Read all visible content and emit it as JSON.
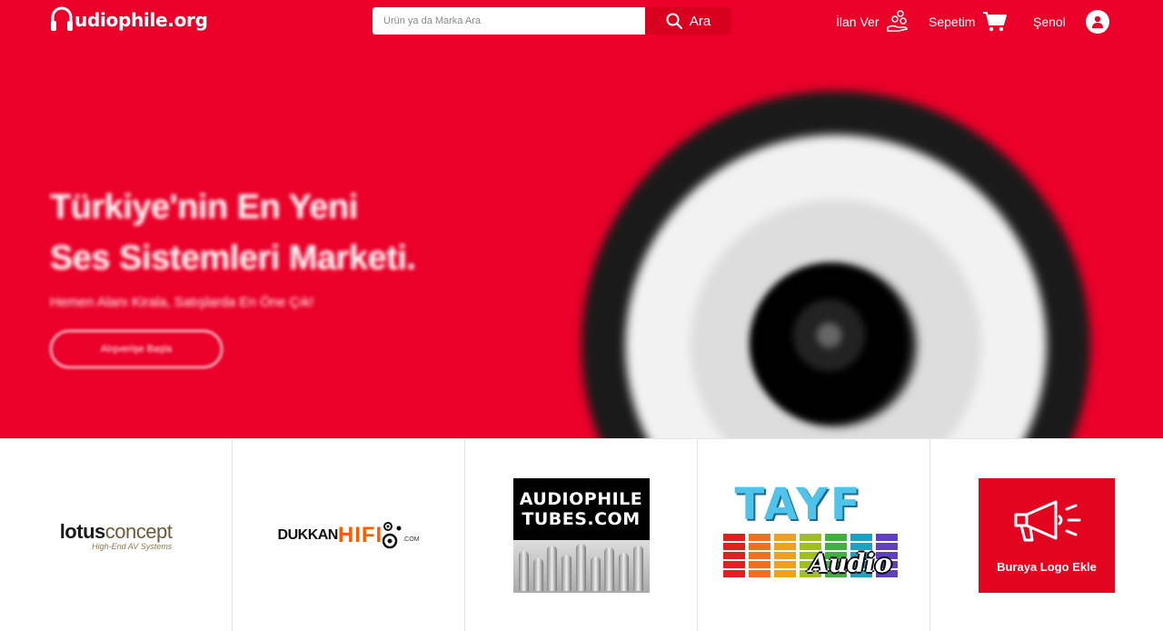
{
  "header": {
    "logo_text": "udiophile.org",
    "search": {
      "placeholder": "Ürün ya da Marka Ara",
      "button_label": "Ara"
    },
    "nav": {
      "post_ad": "İlan Ver",
      "cart": "Sepetim",
      "user": "Şenol"
    }
  },
  "hero": {
    "title_line1": "Türkiye'nin En Yeni",
    "title_line2": "Ses Sistemleri Marketi.",
    "subtitle": "Hemen Alanı Kirala, Satışlarda En Öne Çık!",
    "cta": "Alışverişe Başla"
  },
  "partners": {
    "lotus": {
      "main_bold": "lotus",
      "main_rest": "concept",
      "sub": "High-End AV Systems"
    },
    "dukkan": {
      "part1": "DUKKAN",
      "part2": "HIFI",
      "part3": ".COM"
    },
    "tubes": {
      "line1": "AUDIOPHILE",
      "line2": "TUBES.COM"
    },
    "tayf": {
      "word": "TAYF",
      "sub": "Audio"
    },
    "add_logo": {
      "label": "Buraya Logo Ekle"
    }
  },
  "colors": {
    "brand_red": "#ea0029",
    "search_button": "#d9001f",
    "add_logo_bg": "#e3051f"
  }
}
